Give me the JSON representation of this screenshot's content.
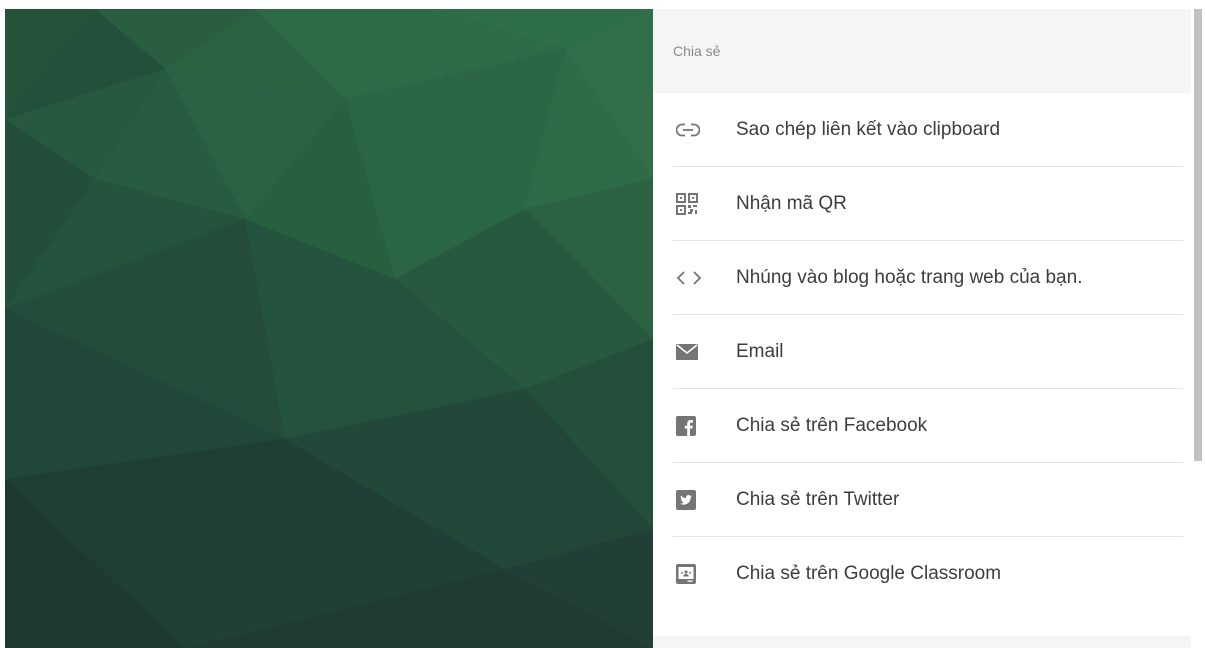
{
  "share": {
    "title": "Chia sẻ",
    "items": [
      {
        "icon": "link-icon",
        "label": "Sao chép liên kết vào clipboard"
      },
      {
        "icon": "qr-code-icon",
        "label": "Nhận mã QR"
      },
      {
        "icon": "code-icon",
        "label": "Nhúng vào blog hoặc trang web của bạn."
      },
      {
        "icon": "email-icon",
        "label": "Email"
      },
      {
        "icon": "facebook-icon",
        "label": "Chia sẻ trên Facebook"
      },
      {
        "icon": "twitter-icon",
        "label": "Chia sẻ trên Twitter"
      },
      {
        "icon": "google-classroom-icon",
        "label": "Chia sẻ trên Google Classroom"
      }
    ]
  },
  "colors": {
    "icon": "#757575",
    "text": "#3d3d3d",
    "header_bg": "#f5f5f5",
    "divider": "#e3e3e3",
    "background_green_light": "#2f7049",
    "background_green_dark": "#1f3a33"
  }
}
